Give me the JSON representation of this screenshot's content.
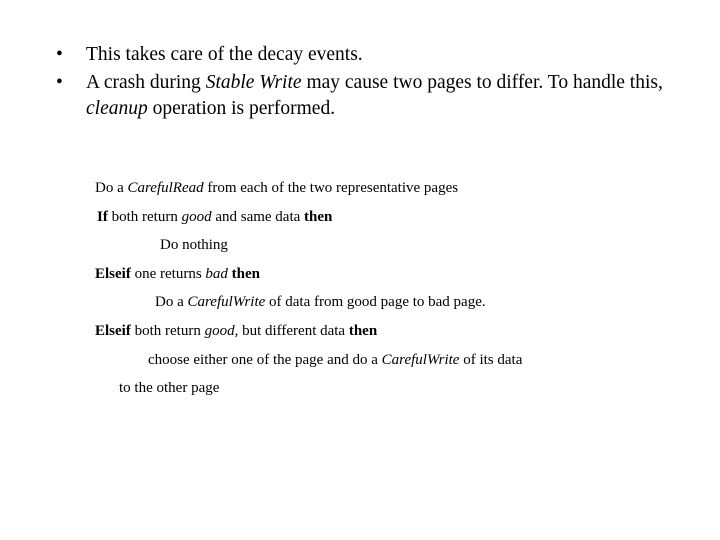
{
  "slide": {
    "background_color": "#ffffff",
    "text_color": "#000000",
    "bullets": [
      {
        "marker": "•",
        "segments": [
          {
            "text": "This takes care of the decay events.",
            "style": "normal"
          }
        ]
      },
      {
        "marker": "•",
        "segments": [
          {
            "text": "A crash during ",
            "style": "normal"
          },
          {
            "text": "Stable Write",
            "style": "italic"
          },
          {
            "text": " may cause two pages to differ. To handle this, ",
            "style": "normal"
          },
          {
            "text": "cleanup",
            "style": "italic"
          },
          {
            "text": " operation is performed.",
            "style": "normal"
          }
        ]
      }
    ],
    "pseudocode": [
      {
        "indent": "ind-0",
        "segments": [
          {
            "text": "Do a ",
            "style": "normal"
          },
          {
            "text": "CarefulRead",
            "style": "italic"
          },
          {
            "text": " from each of the two representative pages",
            "style": "normal"
          }
        ]
      },
      {
        "indent": "ind-1",
        "segments": [
          {
            "text": "If",
            "style": "bold"
          },
          {
            "text": "  both return ",
            "style": "normal"
          },
          {
            "text": "good",
            "style": "italic"
          },
          {
            "text": " and same data ",
            "style": "normal"
          },
          {
            "text": "then",
            "style": "bold"
          }
        ]
      },
      {
        "indent": "ind-2",
        "segments": [
          {
            "text": "Do nothing",
            "style": "normal"
          }
        ]
      },
      {
        "indent": "ind-0",
        "segments": [
          {
            "text": "Elseif",
            "style": "bold"
          },
          {
            "text": " one returns ",
            "style": "normal"
          },
          {
            "text": "bad",
            "style": "italic"
          },
          {
            "text": " ",
            "style": "normal"
          },
          {
            "text": "then",
            "style": "bold"
          }
        ]
      },
      {
        "indent": "ind-3",
        "segments": [
          {
            "text": "Do a ",
            "style": "normal"
          },
          {
            "text": "CarefulWrite",
            "style": "italic"
          },
          {
            "text": " of data from good page to bad page.",
            "style": "normal"
          }
        ]
      },
      {
        "indent": "ind-0",
        "segments": [
          {
            "text": "Elseif",
            "style": "bold"
          },
          {
            "text": " both return ",
            "style": "normal"
          },
          {
            "text": "good",
            "style": "italic"
          },
          {
            "text": ", but different data ",
            "style": "normal"
          },
          {
            "text": "then",
            "style": "bold"
          }
        ]
      },
      {
        "indent": "ind-4",
        "segments": [
          {
            "text": "choose either one of the page and do a ",
            "style": "normal"
          },
          {
            "text": "CarefulWrite",
            "style": "italic"
          },
          {
            "text": " of its data",
            "style": "normal"
          }
        ]
      },
      {
        "indent": "ind-5",
        "segments": [
          {
            "text": "to the other page",
            "style": "normal"
          }
        ]
      }
    ]
  }
}
